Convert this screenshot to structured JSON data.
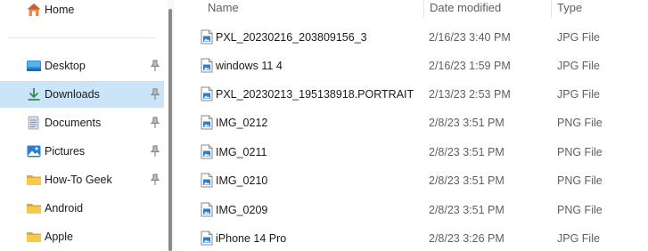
{
  "sidebar": {
    "home": {
      "label": "Home",
      "icon": "home-icon"
    },
    "items": [
      {
        "label": "Desktop",
        "icon": "desktop-icon",
        "pinned": true,
        "selected": false
      },
      {
        "label": "Downloads",
        "icon": "download-icon",
        "pinned": true,
        "selected": true
      },
      {
        "label": "Documents",
        "icon": "documents-icon",
        "pinned": true,
        "selected": false
      },
      {
        "label": "Pictures",
        "icon": "pictures-icon",
        "pinned": true,
        "selected": false
      },
      {
        "label": "How-To Geek",
        "icon": "folder-icon",
        "pinned": true,
        "selected": false
      },
      {
        "label": "Android",
        "icon": "folder-icon",
        "pinned": false,
        "selected": false
      },
      {
        "label": "Apple",
        "icon": "folder-icon",
        "pinned": false,
        "selected": false
      }
    ]
  },
  "columns": {
    "name": "Name",
    "date": "Date modified",
    "type": "Type"
  },
  "files": [
    {
      "name": "PXL_20230216_203809156_3",
      "date": "2/16/23 3:40 PM",
      "type": "JPG File"
    },
    {
      "name": "windows 11 4",
      "date": "2/16/23 1:59 PM",
      "type": "JPG File"
    },
    {
      "name": "PXL_20230213_195138918.PORTRAIT",
      "date": "2/13/23 2:53 PM",
      "type": "JPG File"
    },
    {
      "name": "IMG_0212",
      "date": "2/8/23 3:51 PM",
      "type": "PNG File"
    },
    {
      "name": "IMG_0211",
      "date": "2/8/23 3:51 PM",
      "type": "PNG File"
    },
    {
      "name": "IMG_0210",
      "date": "2/8/23 3:51 PM",
      "type": "PNG File"
    },
    {
      "name": "IMG_0209",
      "date": "2/8/23 3:51 PM",
      "type": "PNG File"
    },
    {
      "name": "iPhone 14 Pro",
      "date": "2/8/23 3:26 PM",
      "type": "JPG File"
    }
  ],
  "colors": {
    "selected_bg": "#cce4f7",
    "folder": "#f4c542",
    "accent": "#2b7cd3"
  }
}
